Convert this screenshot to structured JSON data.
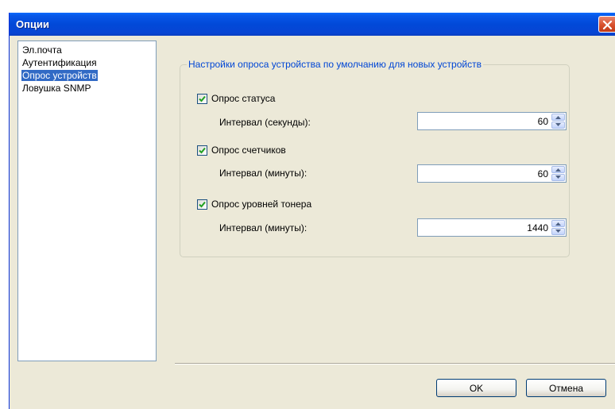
{
  "window": {
    "title": "Опции"
  },
  "nav": {
    "items": [
      {
        "label": "Эл.почта"
      },
      {
        "label": "Аутентификация"
      },
      {
        "label": "Опрос устройств",
        "selected": true
      },
      {
        "label": "Ловушка SNMP"
      }
    ]
  },
  "group": {
    "title": "Настройки опроса устройства по умолчанию для новых устройств",
    "options": [
      {
        "checkbox_label": "Опрос статуса",
        "checked": true,
        "interval_label": "Интервал (секунды):",
        "value": "60"
      },
      {
        "checkbox_label": "Опрос счетчиков",
        "checked": true,
        "interval_label": "Интервал (минуты):",
        "value": "60"
      },
      {
        "checkbox_label": "Опрос уровней тонера",
        "checked": true,
        "interval_label": "Интервал (минуты):",
        "value": "1440"
      }
    ]
  },
  "buttons": {
    "ok": "OK",
    "cancel": "Отмена"
  },
  "icons": {
    "close": "close-icon",
    "check": "checkmark-icon",
    "spin_up": "arrow-up-icon",
    "spin_down": "arrow-down-icon"
  }
}
